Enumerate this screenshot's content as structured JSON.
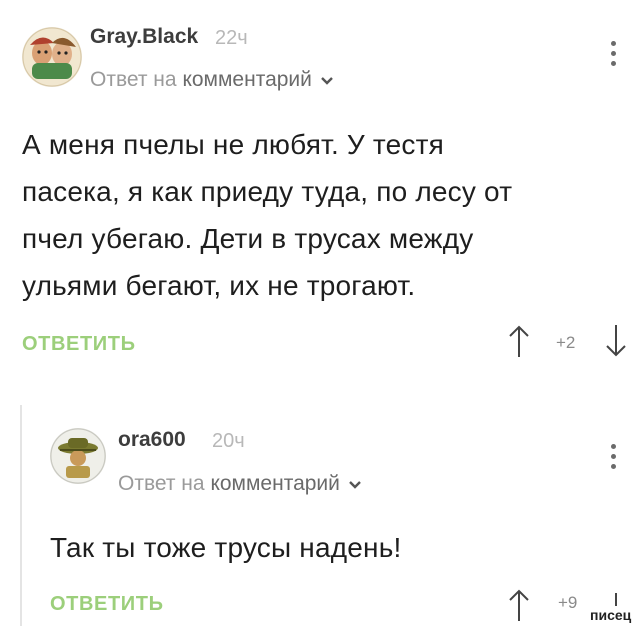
{
  "comments": [
    {
      "author": "Gray.Black",
      "time": "22ч",
      "reply_prefix": "Ответ на",
      "reply_target": "комментарий",
      "text_lines": [
        "А меня пчелы не любят. У тестя",
        "пасека, я как приеду туда, по лесу от",
        "пчел убегаю. Дети в трусах между",
        "ульями бегают, их не трогают."
      ],
      "reply_label": "ОТВЕТИТЬ",
      "rating": "+2"
    },
    {
      "author": "ora600",
      "time": "20ч",
      "reply_prefix": "Ответ на",
      "reply_target": "комментарий",
      "text_lines": [
        "Так ты тоже трусы надень!"
      ],
      "reply_label": "ОТВЕТИТЬ",
      "rating": "+9"
    }
  ],
  "watermark": "писец",
  "colors": {
    "reply_button": "#9ccf7b",
    "text": "#1e1e1e",
    "muted": "#9a9a9a"
  }
}
